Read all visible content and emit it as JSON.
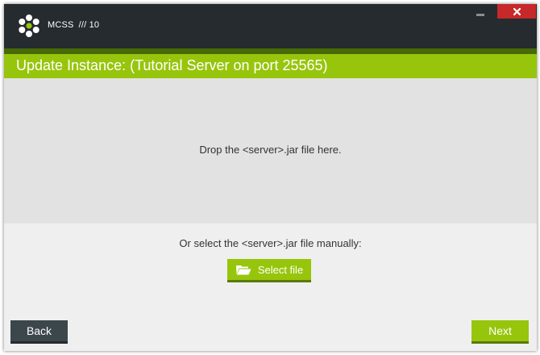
{
  "window": {
    "app_name": "MCSS",
    "app_version": "/// 10",
    "controls": {
      "minimize_icon": "minimize-icon",
      "close_icon": "close-icon"
    }
  },
  "header": {
    "title": "Update Instance: (Tutorial Server on port 25565)"
  },
  "drop_zone": {
    "text": "Drop the <server>.jar file here."
  },
  "manual_select": {
    "label": "Or select the <server>.jar file manually:",
    "button_label": "Select file",
    "button_icon": "folder-open-icon"
  },
  "footer": {
    "back_label": "Back",
    "next_label": "Next"
  },
  "colors": {
    "accent_green": "#97c50c",
    "titlebar_dark": "#252b2f",
    "close_red": "#c7282a",
    "back_button": "#3c474c"
  }
}
